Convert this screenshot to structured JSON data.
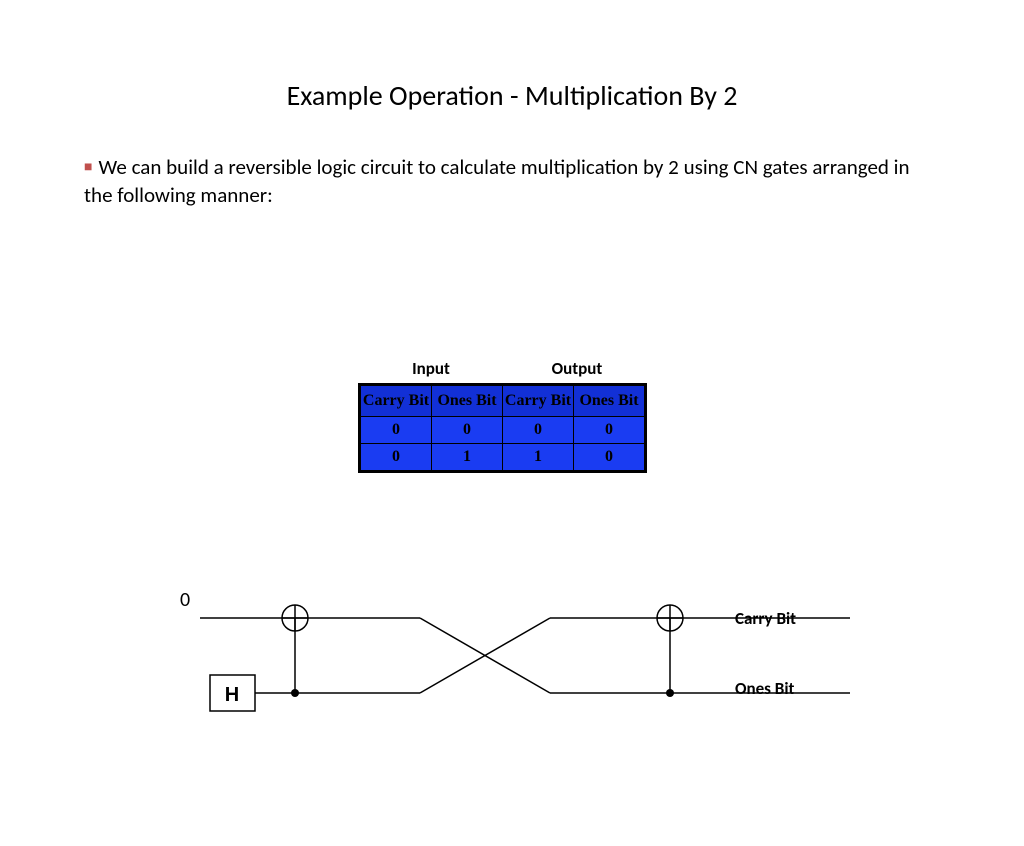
{
  "title": "Example Operation - Multiplication By 2",
  "body_text": "We can build a reversible logic circuit to calculate multiplication by 2 using CN gates arranged in the following manner:",
  "table": {
    "input_label": "Input",
    "output_label": "Output",
    "headers": [
      "Carry Bit",
      "Ones Bit",
      "Carry Bit",
      "Ones Bit"
    ],
    "rows": [
      [
        "0",
        "0",
        "0",
        "0"
      ],
      [
        "0",
        "1",
        "1",
        "0"
      ]
    ]
  },
  "circuit": {
    "top_left_label": "0",
    "h_block": "H",
    "carry_label": "Carry Bit",
    "ones_label": "Ones Bit"
  }
}
